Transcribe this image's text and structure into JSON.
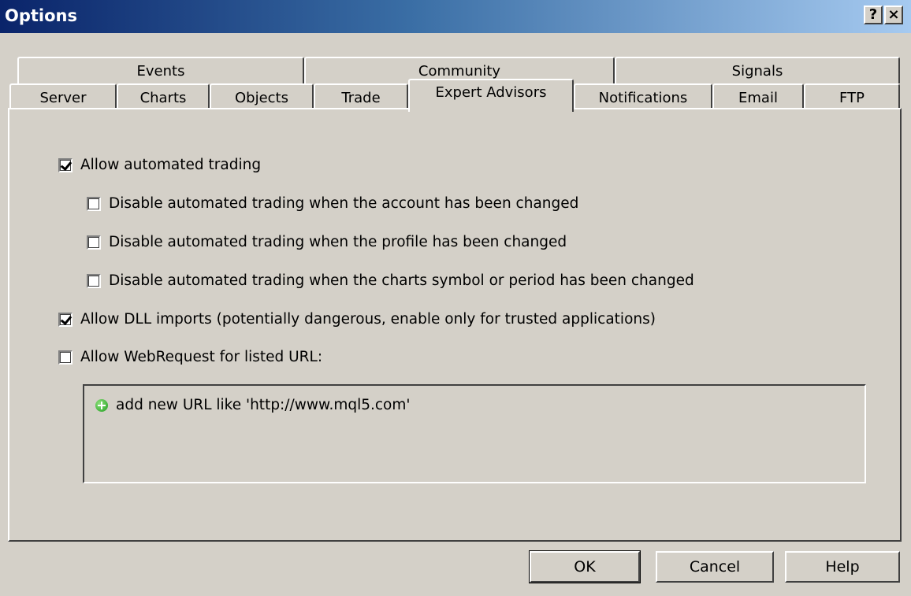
{
  "window": {
    "title": "Options",
    "help_button": "?",
    "close_button": "×"
  },
  "tabs_row_top": [
    {
      "label": "Events"
    },
    {
      "label": "Community"
    },
    {
      "label": "Signals"
    }
  ],
  "tabs_row_bottom": [
    {
      "label": "Server"
    },
    {
      "label": "Charts"
    },
    {
      "label": "Objects"
    },
    {
      "label": "Trade"
    },
    {
      "label": "Expert Advisors",
      "selected": true
    },
    {
      "label": "Notifications"
    },
    {
      "label": "Email"
    },
    {
      "label": "FTP"
    }
  ],
  "options": {
    "allow_automated_trading": {
      "label": "Allow automated trading",
      "checked": true
    },
    "disable_on_account_change": {
      "label": "Disable automated trading when the account has been changed",
      "checked": false
    },
    "disable_on_profile_change": {
      "label": "Disable automated trading when the profile has been changed",
      "checked": false
    },
    "disable_on_symbol_change": {
      "label": "Disable automated trading when the charts symbol or period has been changed",
      "checked": false
    },
    "allow_dll_imports": {
      "label": "Allow DLL imports (potentially dangerous, enable only for trusted applications)",
      "checked": true
    },
    "allow_webrequest": {
      "label": "Allow WebRequest for listed URL:",
      "checked": false
    }
  },
  "url_list": {
    "add_hint": "add new URL like 'http://www.mql5.com'",
    "add_icon": "plus-circle-icon"
  },
  "buttons": {
    "ok": "OK",
    "cancel": "Cancel",
    "help": "Help"
  }
}
